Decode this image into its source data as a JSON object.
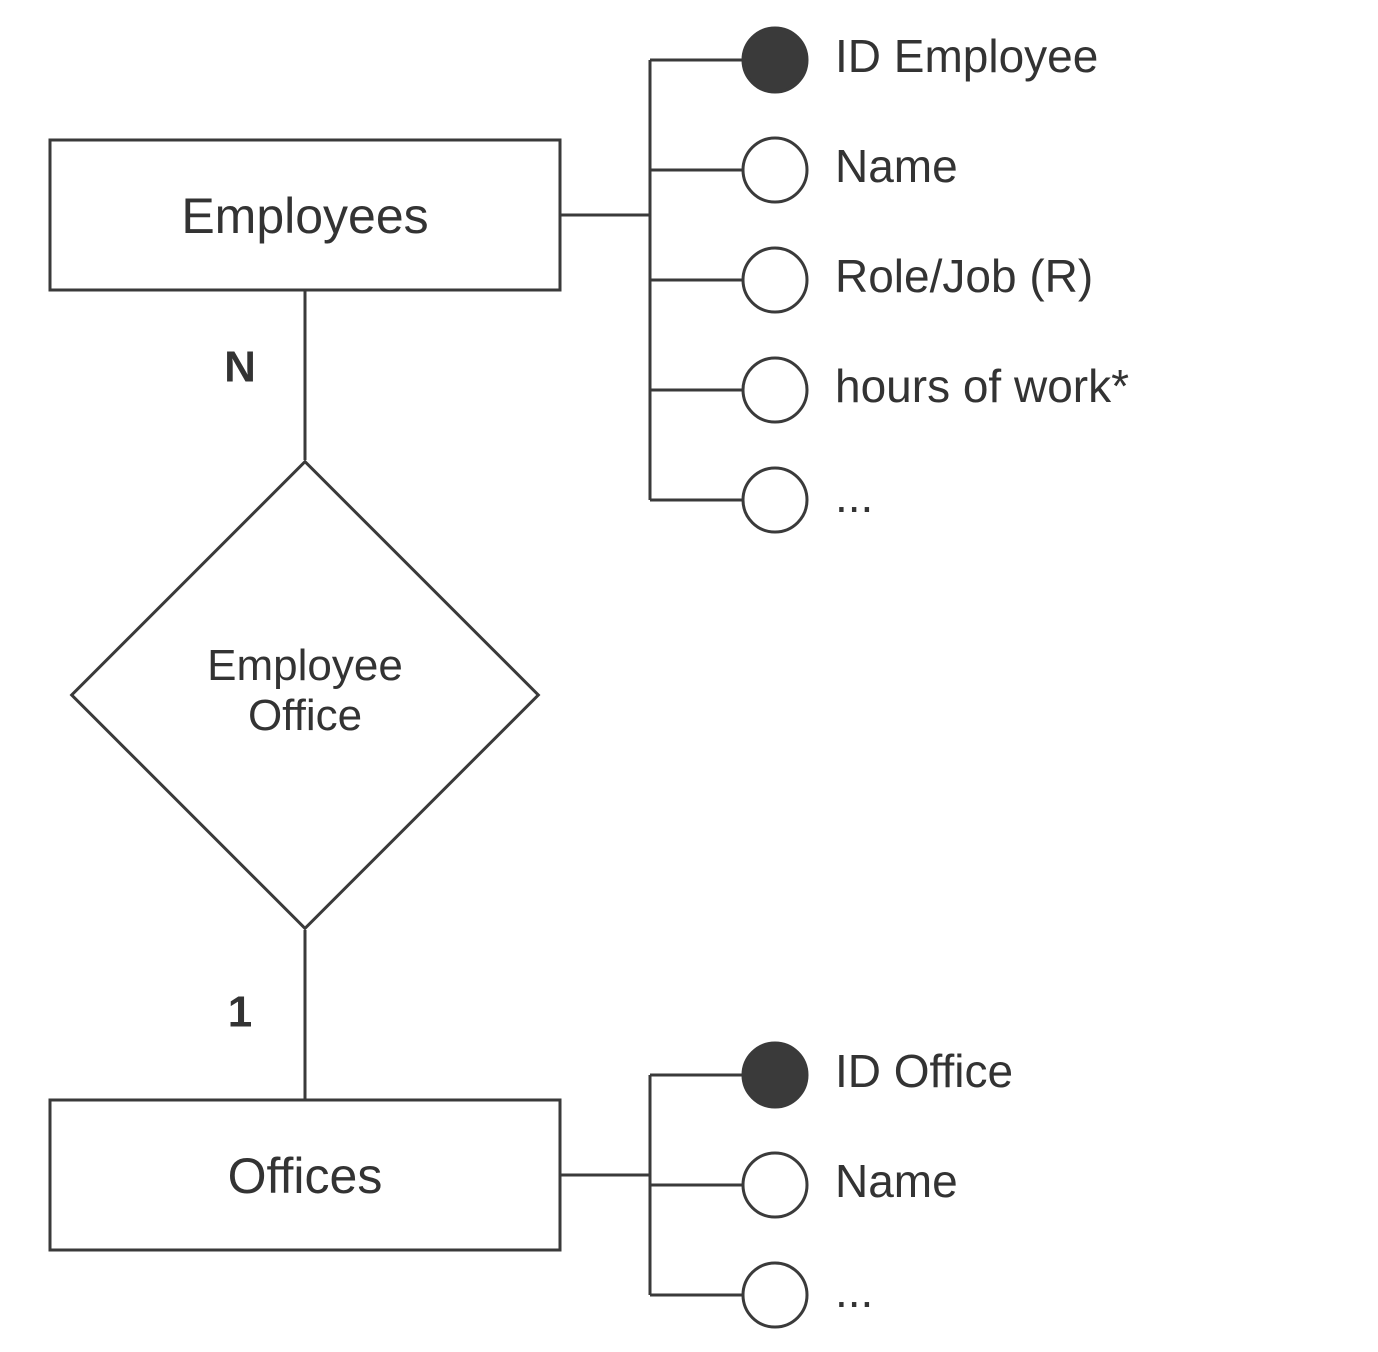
{
  "entities": {
    "employees": {
      "label": "Employees",
      "attributes": [
        {
          "label": "ID Employee",
          "key": true
        },
        {
          "label": "Name",
          "key": false
        },
        {
          "label": "Role/Job (R)",
          "key": false
        },
        {
          "label": "hours of work*",
          "key": false
        },
        {
          "label": "...",
          "key": false
        }
      ]
    },
    "offices": {
      "label": "Offices",
      "attributes": [
        {
          "label": "ID Office",
          "key": true
        },
        {
          "label": "Name",
          "key": false
        },
        {
          "label": "...",
          "key": false
        }
      ]
    }
  },
  "relationship": {
    "label_line1": "Employee",
    "label_line2": "Office",
    "cardinality_top": "N",
    "cardinality_bottom": "1"
  }
}
